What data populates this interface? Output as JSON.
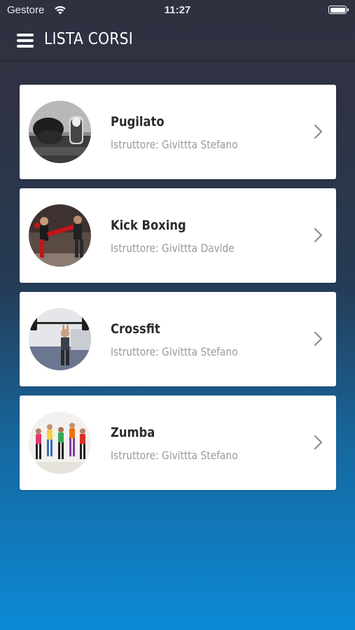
{
  "status_bar": {
    "carrier": "Gestore",
    "time": "11:27",
    "icons": [
      "wifi-icon",
      "battery-icon"
    ]
  },
  "header": {
    "title": "LISTA CORSI",
    "menu_icon": "hamburger-menu-icon"
  },
  "colors": {
    "header_bg": "#2e3140",
    "gradient_bottom": "#0c8ad6",
    "card_bg": "#ffffff",
    "title_text": "#2b2b2b",
    "subtitle_text": "#9a9a9a"
  },
  "courses": [
    {
      "name": "Pugilato",
      "instructor": "Istruttore: Givittta Stefano",
      "image": "boxing-photo"
    },
    {
      "name": "Kick Boxing",
      "instructor": "Istruttore: Givittta Davide",
      "image": "kickboxing-photo"
    },
    {
      "name": "Crossfit",
      "instructor": "Istruttore: Givittta Stefano",
      "image": "crossfit-photo"
    },
    {
      "name": "Zumba",
      "instructor": "Istruttore: Givittta Stefano",
      "image": "zumba-photo"
    }
  ]
}
